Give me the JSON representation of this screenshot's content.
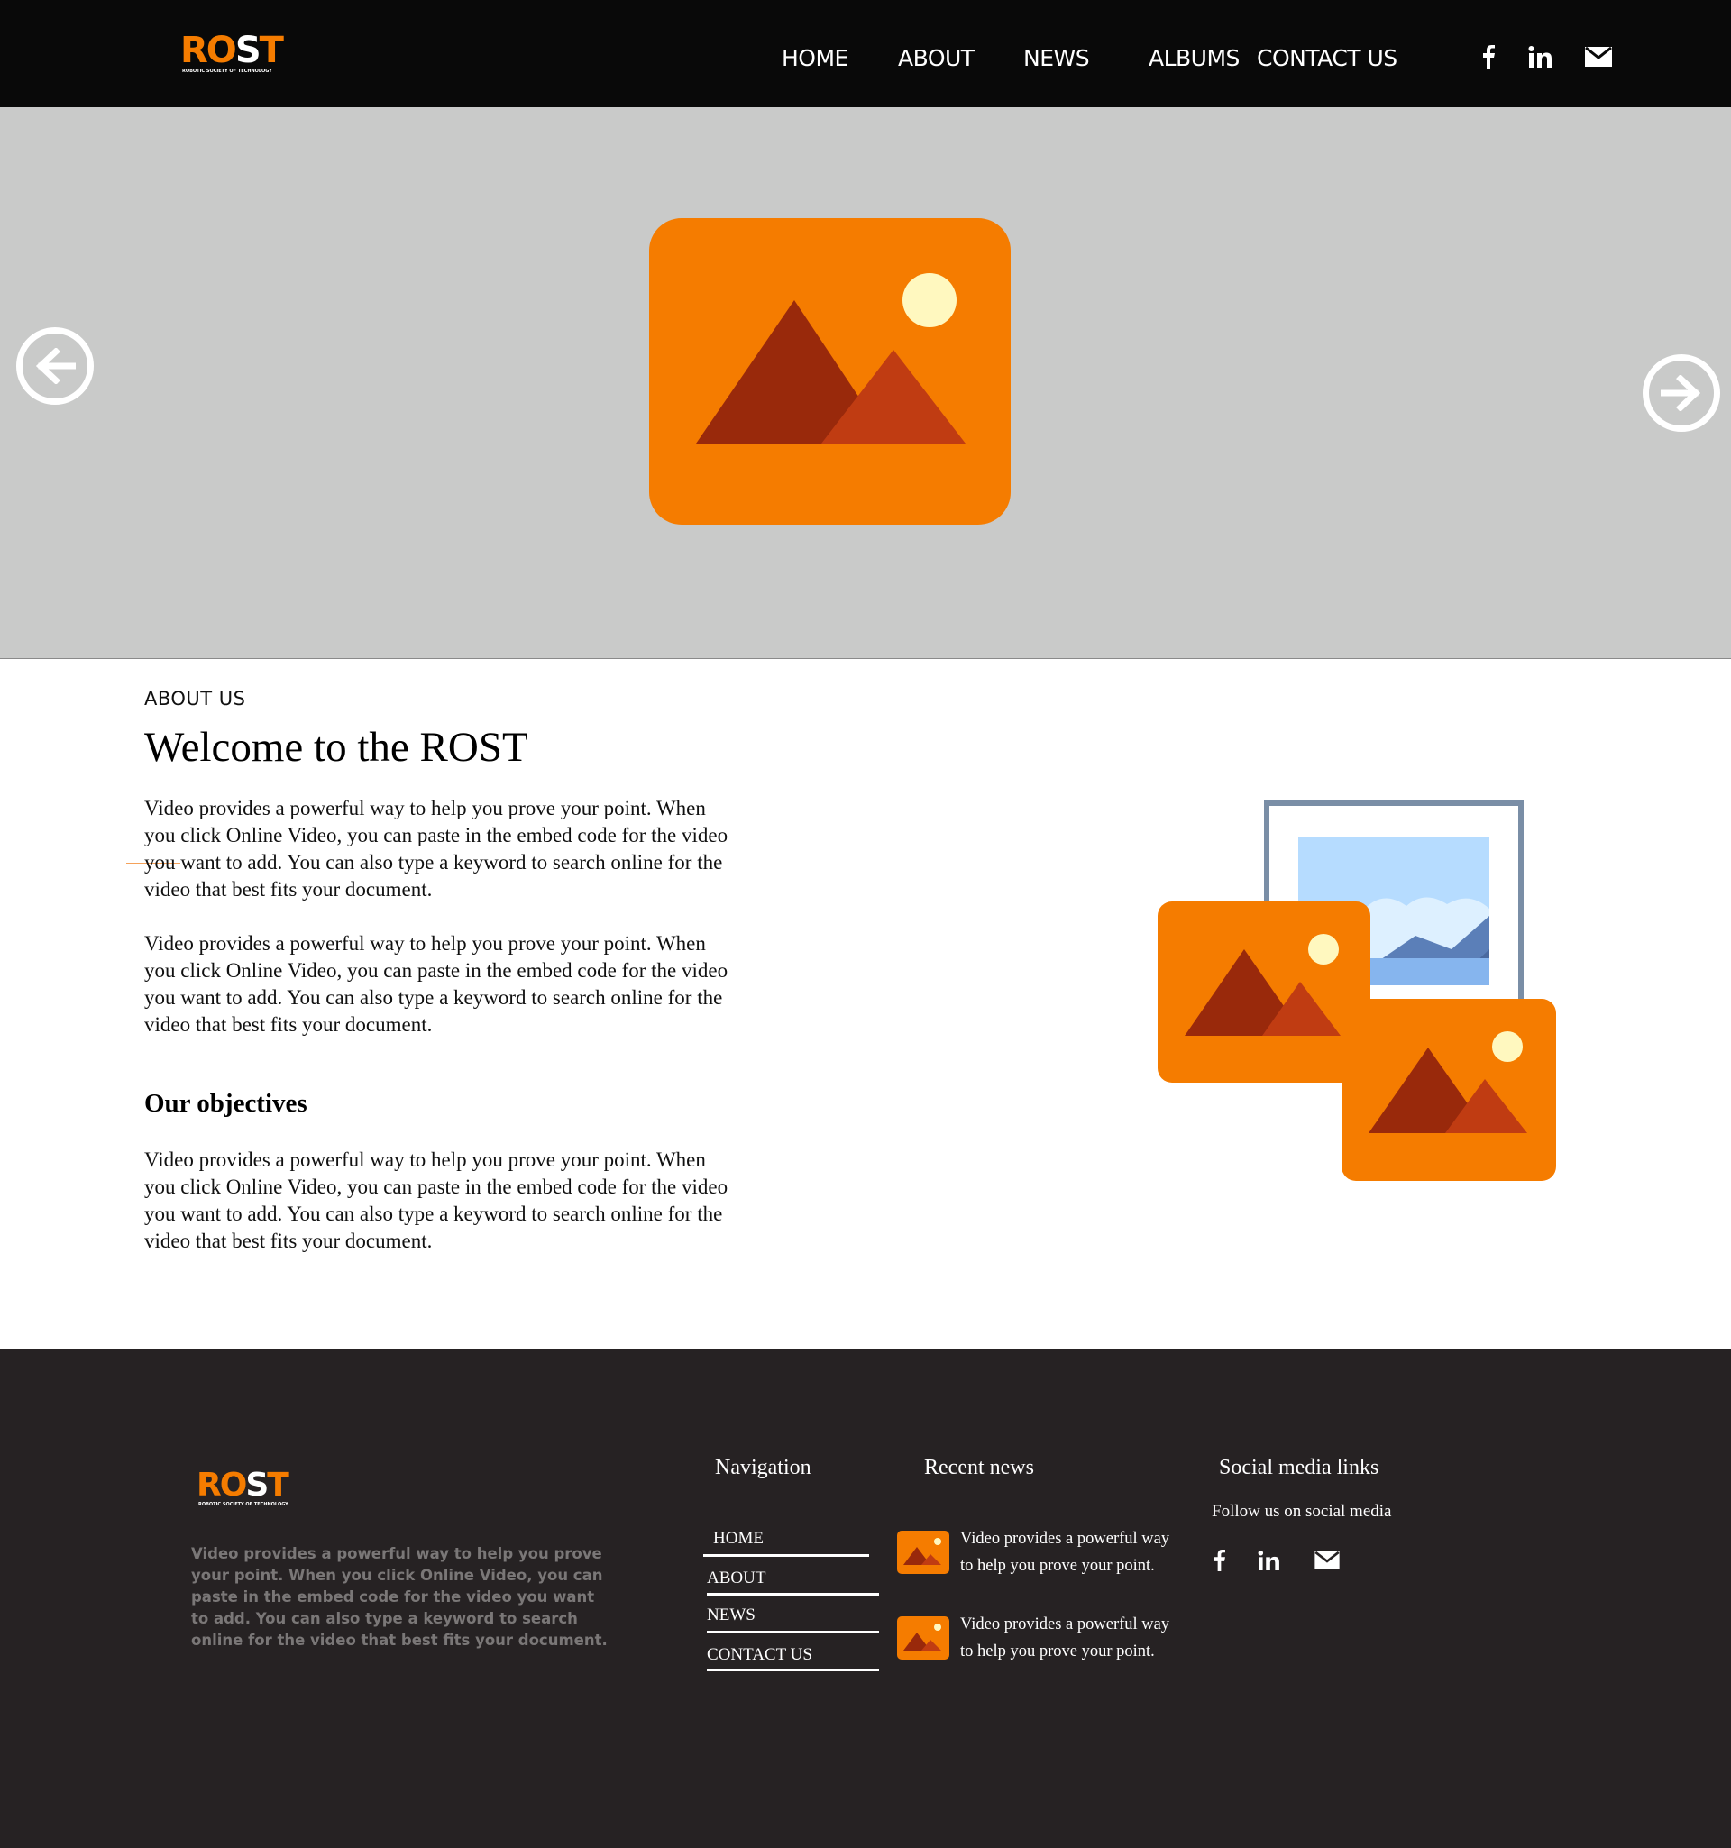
{
  "brand": {
    "logo_main": "ROST",
    "logo_tagline": "ROBOTIC SOCIETY OF TECHNOLOGY",
    "accent_color": "#f57c00",
    "header_bg": "#090909",
    "footer_bg": "#262223",
    "hero_bg": "#c9cac9"
  },
  "nav": {
    "items": [
      {
        "label": "HOME"
      },
      {
        "label": "ABOUT"
      },
      {
        "label": "NEWS"
      },
      {
        "label": "ALBUMS"
      },
      {
        "label": "CONTACT US"
      }
    ]
  },
  "social_icons": [
    "facebook-icon",
    "linkedin-icon",
    "mail-icon"
  ],
  "hero": {
    "prev_icon": "arrow-left-circle-icon",
    "next_icon": "arrow-right-circle-icon",
    "image_icon": "image-placeholder-icon"
  },
  "about": {
    "eyebrow": "ABOUT US",
    "title": "Welcome to the ROST",
    "paragraphs": [
      "Video provides a powerful way to help you prove your point. When you click Online Video, you can paste in the embed code for the video you want to add. You can also type a keyword to search online for the video that best fits your document.",
      "Video provides a powerful way to help you prove your point. When you click Online Video, you can paste in the embed code for the video you want to add. You can also type a keyword to search online for the video that best fits your document."
    ],
    "objectives_title": "Our objectives",
    "objectives_text": "Video provides a powerful way to help you prove your point. When you click Online Video, you can paste in the embed code for the video you want to add. You can also type a keyword to search online for the video that best fits your document."
  },
  "footer": {
    "description": "Video provides a powerful way to help you prove your point. When you click Online Video, you can paste in the embed code for the video you want to add. You can also type a keyword to search online for the video that best fits your document.",
    "navigation_heading": "Navigation",
    "nav_links": [
      {
        "label": "HOME"
      },
      {
        "label": "ABOUT"
      },
      {
        "label": "NEWS"
      },
      {
        "label": "CONTACT US"
      }
    ],
    "news_heading": "Recent news",
    "news": [
      {
        "text": "Video provides a powerful way to help you prove your point."
      },
      {
        "text": "Video provides a powerful way to help you prove your point."
      }
    ],
    "social_heading": "Social media links",
    "social_text": "Follow us on social media"
  }
}
